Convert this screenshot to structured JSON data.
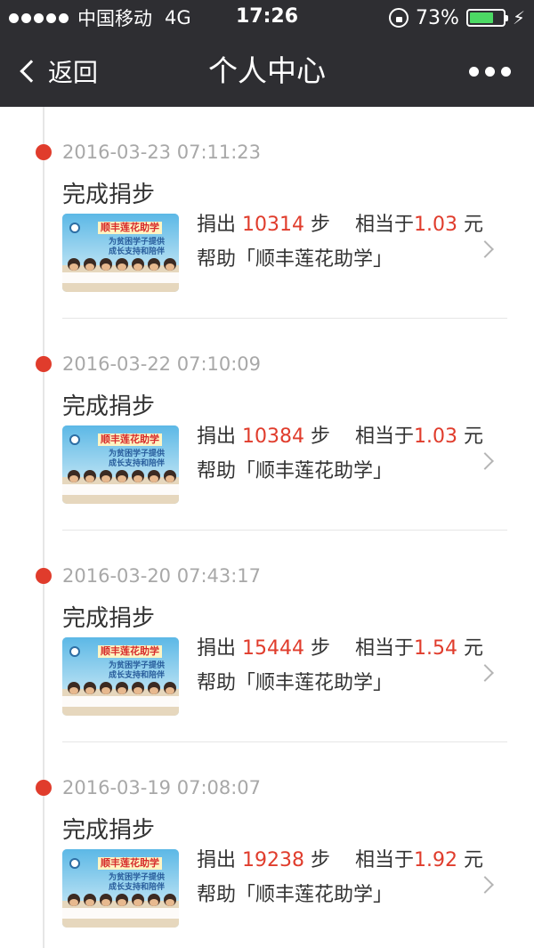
{
  "status_bar": {
    "carrier": "中国移动",
    "network": "4G",
    "time": "17:26",
    "battery": "73%",
    "battery_level": 0.73,
    "battery_color": "#4cd964"
  },
  "navbar": {
    "back_label": "返回",
    "title": "个人中心",
    "more_icon": "more-dots-icon"
  },
  "colors": {
    "bar_background": "#2e2e32",
    "accent_red": "#e03c2c",
    "timestamp_gray": "#a8a8a8"
  },
  "records": [
    {
      "time": "2016-03-23 07:11:23",
      "title": "完成捐步",
      "donate_label": "捐出",
      "steps": "10314",
      "steps_unit": "步",
      "equiv_label": "相当于",
      "amount": "1.03",
      "amount_unit": "元",
      "help_text": "帮助「顺丰莲花助学」",
      "thumb": {
        "banner": "顺丰莲花助学",
        "line1": "为贫困学子提供",
        "line2": "成长支持和陪伴"
      }
    },
    {
      "time": "2016-03-22 07:10:09",
      "title": "完成捐步",
      "donate_label": "捐出",
      "steps": "10384",
      "steps_unit": "步",
      "equiv_label": "相当于",
      "amount": "1.03",
      "amount_unit": "元",
      "help_text": "帮助「顺丰莲花助学」",
      "thumb": {
        "banner": "顺丰莲花助学",
        "line1": "为贫困学子提供",
        "line2": "成长支持和陪伴"
      }
    },
    {
      "time": "2016-03-20 07:43:17",
      "title": "完成捐步",
      "donate_label": "捐出",
      "steps": "15444",
      "steps_unit": "步",
      "equiv_label": "相当于",
      "amount": "1.54",
      "amount_unit": "元",
      "help_text": "帮助「顺丰莲花助学」",
      "thumb": {
        "banner": "顺丰莲花助学",
        "line1": "为贫困学子提供",
        "line2": "成长支持和陪伴"
      }
    },
    {
      "time": "2016-03-19 07:08:07",
      "title": "完成捐步",
      "donate_label": "捐出",
      "steps": "19238",
      "steps_unit": "步",
      "equiv_label": "相当于",
      "amount": "1.92",
      "amount_unit": "元",
      "help_text": "帮助「顺丰莲花助学」",
      "thumb": {
        "banner": "顺丰莲花助学",
        "line1": "为贫困学子提供",
        "line2": "成长支持和陪伴"
      }
    }
  ]
}
